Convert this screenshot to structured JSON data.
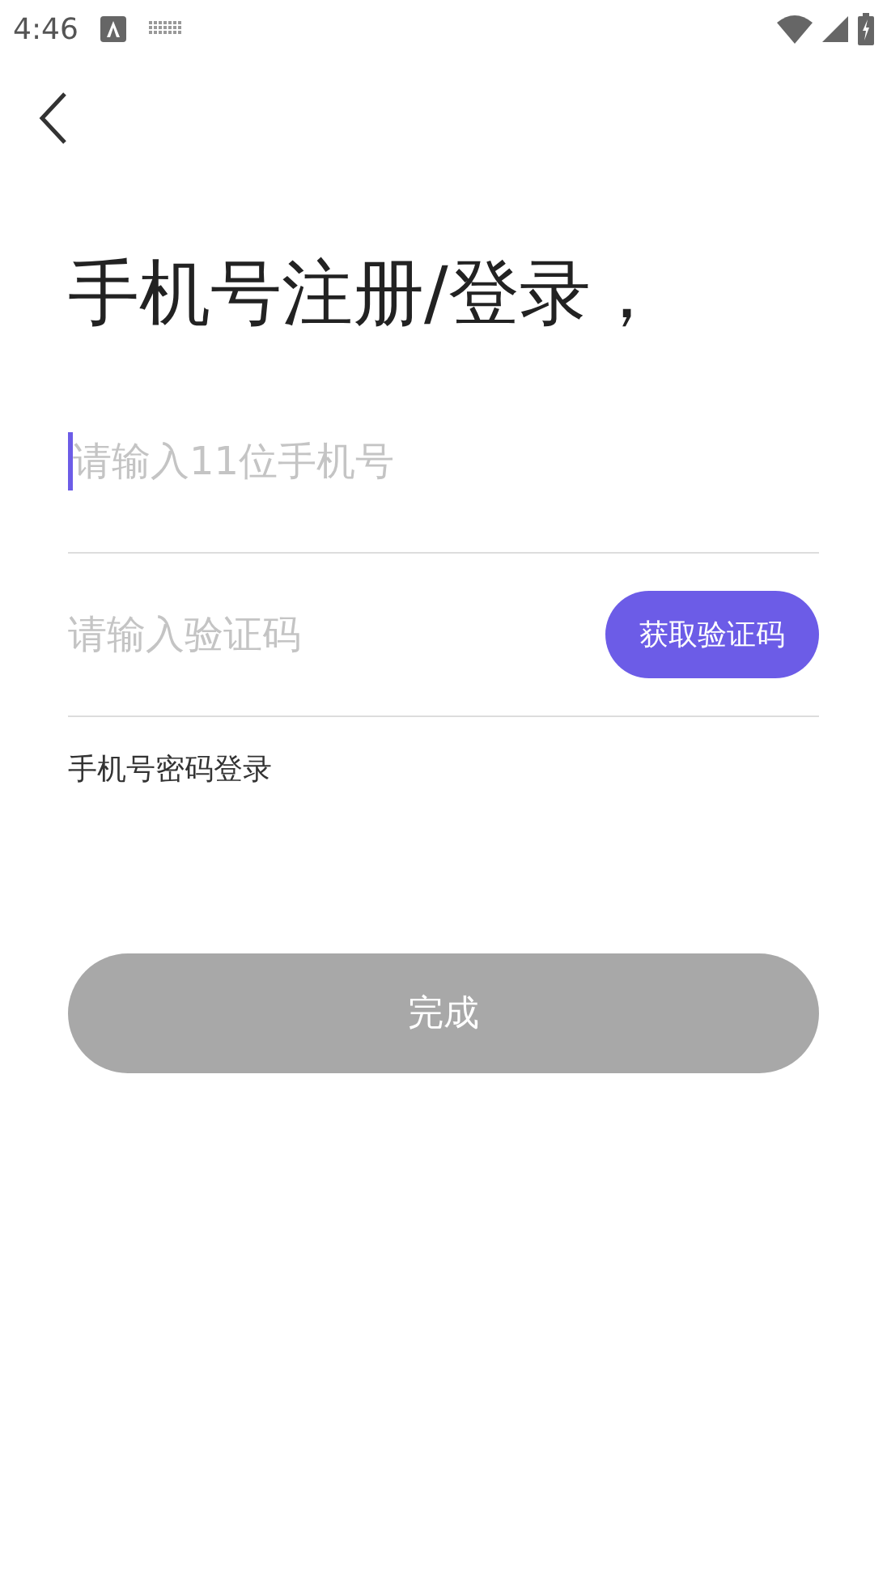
{
  "status_bar": {
    "time": "4:46"
  },
  "title": "手机号注册/登录，",
  "phone_field": {
    "placeholder": "请输入11位手机号",
    "focused": true
  },
  "code_field": {
    "placeholder": "请输入验证码"
  },
  "get_code_button": {
    "label": "获取验证码"
  },
  "password_login_link": "手机号密码登录",
  "submit_button": {
    "label": "完成",
    "disabled": true
  }
}
